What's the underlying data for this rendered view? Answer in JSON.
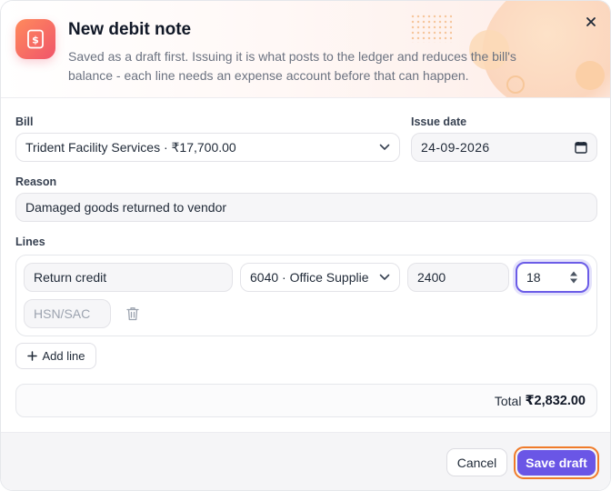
{
  "dialog": {
    "title": "New debit note",
    "subtitle": "Saved as a draft first. Issuing it is what posts to the ledger and reduces the bill's balance - each line needs an expense account before that can happen.",
    "accent_color": "#6a56e6",
    "icon_gradient": [
      "#ff8a5c",
      "#f0556b"
    ]
  },
  "form": {
    "bill_label": "Bill",
    "bill_value": "Trident Facility Services · ₹17,700.00",
    "issue_date_label": "Issue date",
    "issue_date_value": "24-09-2026",
    "reason_label": "Reason",
    "reason_value": "Damaged goods returned to vendor",
    "lines_label": "Lines"
  },
  "lines": [
    {
      "description": "Return credit",
      "account": "6040 · Office Supplie",
      "amount": "2400",
      "tax_rate": "18",
      "hsn_placeholder": "HSN/SAC"
    }
  ],
  "actions": {
    "add_line": "Add line",
    "cancel": "Cancel",
    "save_draft": "Save draft"
  },
  "totals": {
    "label": "Total",
    "amount": "₹2,832.00"
  }
}
